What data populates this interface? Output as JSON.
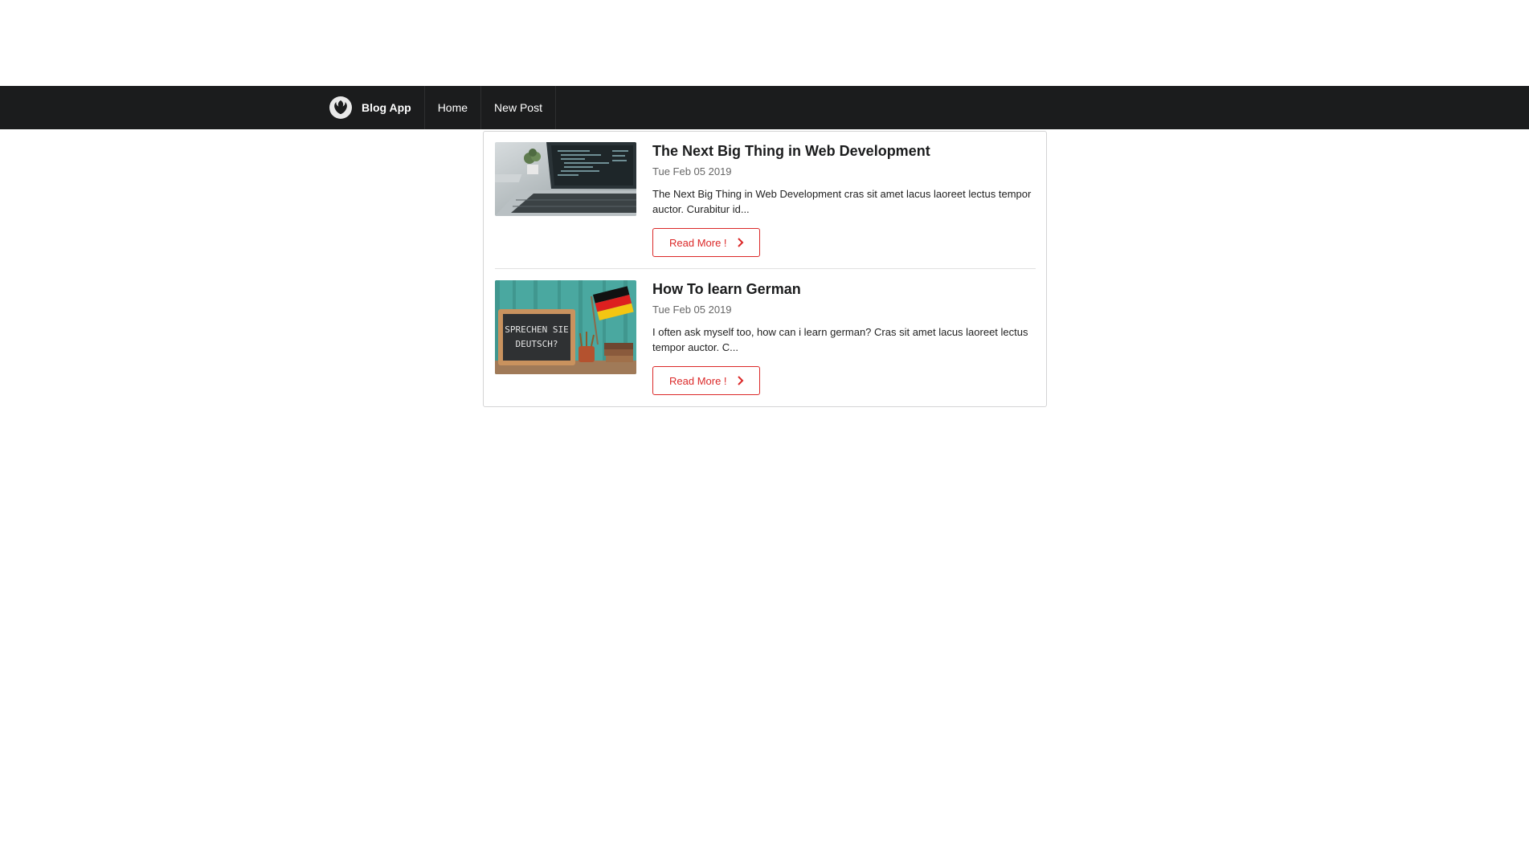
{
  "navbar": {
    "brand_label": "Blog App",
    "logo_icon": "rebel-alliance-icon",
    "items": [
      {
        "label": "Home"
      },
      {
        "label": "New Post"
      }
    ]
  },
  "posts": [
    {
      "title": "The Next Big Thing in Web Development",
      "date": "Tue Feb 05 2019",
      "excerpt": "The Next Big Thing in Web Development cras sit amet lacus laoreet lectus tempor auctor. Curabitur id...",
      "thumbnail": "laptop-code-image",
      "read_more_label": "Read More !"
    },
    {
      "title": "How To learn German",
      "date": "Tue Feb 05 2019",
      "excerpt": "I often ask myself too, how can i learn german? Cras sit amet lacus laoreet lectus tempor auctor. C...",
      "thumbnail": "chalkboard-german-flag-image",
      "thumbnail_chalk_text": [
        "SPRECHEN SIE",
        "DEUTSCH?"
      ],
      "read_more_label": "Read More !"
    }
  ],
  "colors": {
    "navbar_bg": "#1b1c1d",
    "accent_red": "#db2828",
    "border": "#d4d4d5"
  }
}
